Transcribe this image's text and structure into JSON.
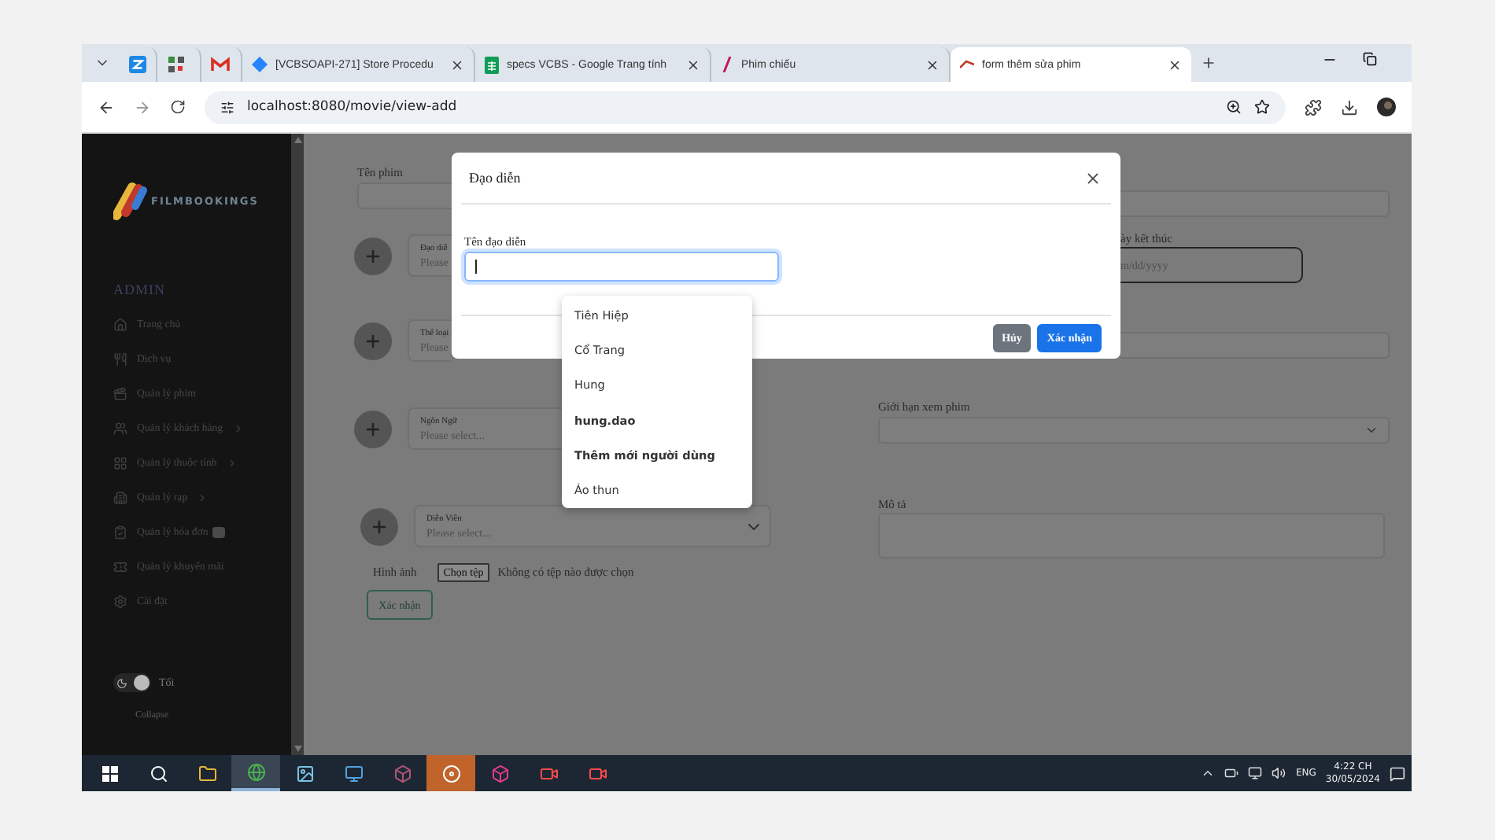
{
  "browser": {
    "tabs": [
      {
        "selected": false
      },
      {
        "selected": false
      },
      {
        "selected": false
      },
      {
        "title": "[VCBSOAPI-271] Store Procedu",
        "selected": false
      },
      {
        "title": "specs VCBS - Google Trang tính",
        "selected": false
      },
      {
        "title": "Phim chiếu",
        "selected": false
      },
      {
        "title": "form thêm sửa phim",
        "selected": true
      }
    ],
    "url": "localhost:8080/movie/view-add"
  },
  "sidebar": {
    "brand": "FILMBOOKINGS",
    "section": "ADMIN",
    "items": [
      {
        "label": "Trang chủ",
        "has_submenu": false,
        "badge": false
      },
      {
        "label": "Dịch vụ",
        "has_submenu": false,
        "badge": false
      },
      {
        "label": "Quản lý phim",
        "has_submenu": false,
        "badge": false
      },
      {
        "label": "Quản lý khách hàng",
        "has_submenu": true,
        "badge": false
      },
      {
        "label": "Quản lý thuộc tính",
        "has_submenu": true,
        "badge": false
      },
      {
        "label": "Quản lý rạp",
        "has_submenu": true,
        "badge": false
      },
      {
        "label": "Quản lý hóa đơn",
        "has_submenu": false,
        "badge": true
      },
      {
        "label": "Quản lý khuyến mãi",
        "has_submenu": false,
        "badge": false
      },
      {
        "label": "Cài đặt",
        "has_submenu": false,
        "badge": false
      }
    ],
    "theme_toggle": {
      "label": "Tối",
      "on": true
    },
    "collapse": "Collapse"
  },
  "form": {
    "title_field": {
      "label": "Tên phim"
    },
    "pickers": [
      {
        "label": "Đạo diễ",
        "placeholder": "Please"
      },
      {
        "label": "Thể loại",
        "placeholder": "Please"
      },
      {
        "label": "Ngôn Ngữ",
        "placeholder": "Please select..."
      },
      {
        "label": "Diễn Viên",
        "placeholder": "Please select..."
      }
    ],
    "end_date": {
      "label": "ày kết thúc",
      "placeholder": "m/dd/yyyy"
    },
    "age_limit": {
      "label": "Giới hạn xem phim"
    },
    "description": {
      "label": "Mô tả"
    },
    "image": {
      "label": "Hình ảnh",
      "button": "Chọn tệp",
      "status": "Không có tệp nào được chọn"
    },
    "submit": "Xác nhận"
  },
  "modal": {
    "title": "Đạo diễn",
    "field_label": "Tên đạo diễn",
    "buttons": [
      {
        "label": "Hủy",
        "kind": "secondary"
      },
      {
        "label": "Xác nhận",
        "kind": "primary"
      }
    ]
  },
  "suggestions": [
    {
      "label": "Tiên Hiệp",
      "bold": false
    },
    {
      "label": "Cổ Trang",
      "bold": false
    },
    {
      "label": "Hung",
      "bold": false
    },
    {
      "label": "hung.dao",
      "bold": true
    },
    {
      "label": "Thêm mới người dùng",
      "bold": true
    },
    {
      "label": "Áo thun",
      "bold": false
    }
  ],
  "taskbar": {
    "apps": [
      {
        "active": false
      },
      {
        "active": true
      },
      {
        "active": false
      },
      {
        "active": false
      },
      {
        "active": false
      },
      {
        "active": false
      },
      {
        "active": false
      },
      {
        "active": false
      },
      {
        "active": false
      }
    ],
    "language": "ENG",
    "time": "4:22 CH",
    "date": "30/05/2024"
  }
}
